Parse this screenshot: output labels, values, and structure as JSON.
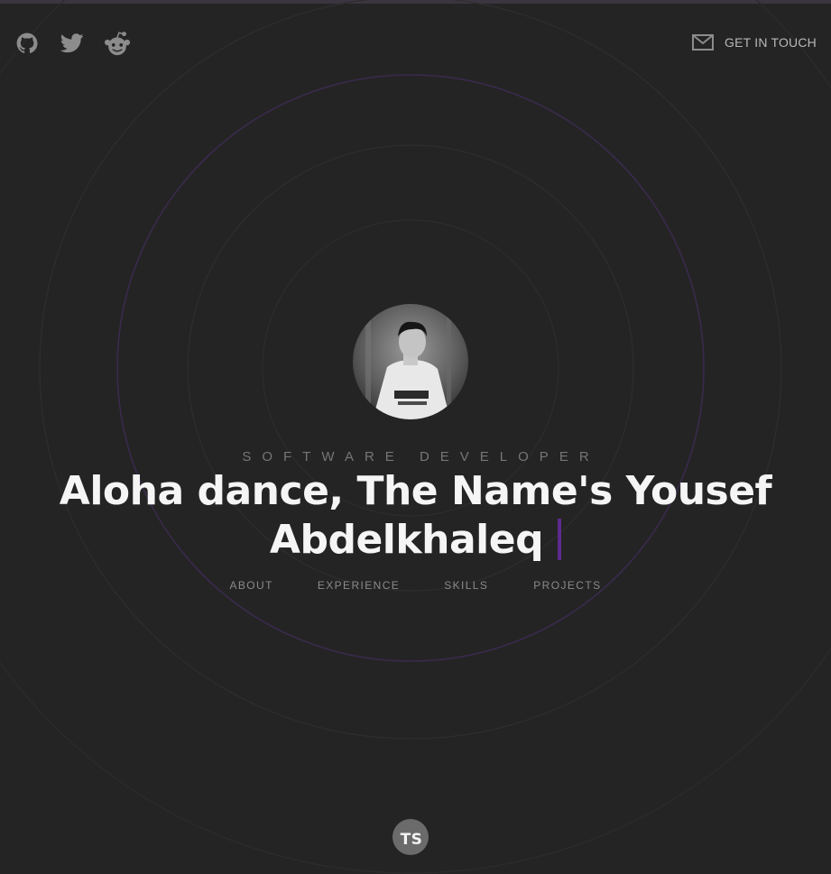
{
  "header": {
    "socials": [
      {
        "name": "github",
        "icon": "github-icon"
      },
      {
        "name": "twitter",
        "icon": "twitter-icon"
      },
      {
        "name": "reddit",
        "icon": "reddit-icon"
      }
    ],
    "contact_label": "GET IN TOUCH",
    "contact_icon": "mail-icon"
  },
  "hero": {
    "subtitle": "SOFTWARE DEVELOPER",
    "headline_line1": "Aloha dance, The Name's Yousef",
    "headline_line2": "Abdelkhaleq",
    "cursor_color": "#5d2b8f"
  },
  "nav": {
    "items": [
      "ABOUT",
      "EXPERIENCE",
      "SKILLS",
      "PROJECTS"
    ]
  },
  "footer": {
    "badge_text": "TS"
  },
  "colors": {
    "background": "#242424",
    "accent": "#4a2670",
    "icon_gray": "#8a8a8a"
  }
}
